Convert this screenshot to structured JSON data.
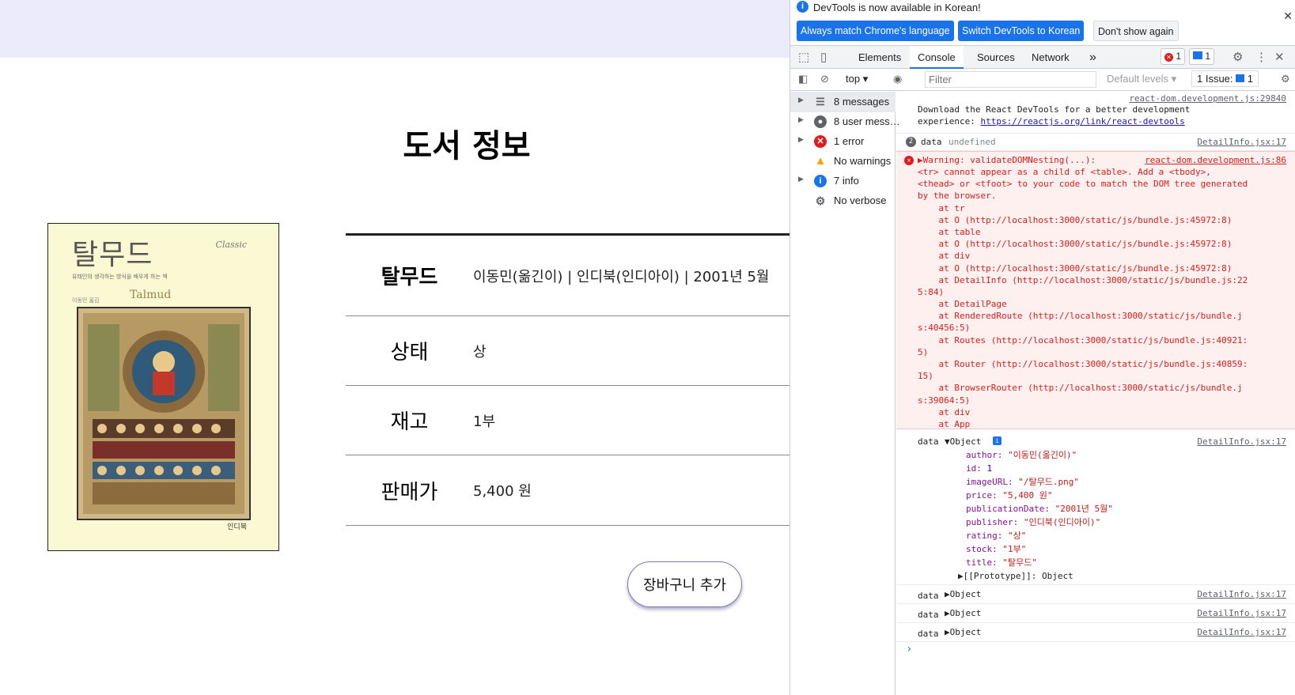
{
  "page": {
    "title": "도서 정보",
    "cover": {
      "title": "탈무드",
      "subtitle": "유태인의 생각하는 방식을 배우게 하는 책",
      "series": "Classic",
      "author": "이동민 옮김",
      "english_title": "Talmud",
      "publisher": "인디북"
    },
    "rows": [
      {
        "label": "탈무드",
        "value": "이동민(옮긴이) | 인디북(인디아이) | 2001년 5월"
      },
      {
        "label": "상태",
        "value": "상"
      },
      {
        "label": "재고",
        "value": "1부"
      },
      {
        "label": "판매가",
        "value": "5,400 원"
      }
    ],
    "cart_button": "장바구니 추가"
  },
  "devtools": {
    "notice": {
      "text": "DevTools is now available in Korean!",
      "btn_match": "Always match Chrome's language",
      "btn_switch": "Switch DevTools to Korean",
      "btn_dismiss": "Don't show again"
    },
    "tabs": [
      "Elements",
      "Console",
      "Sources",
      "Network"
    ],
    "more_tabs": "»",
    "error_count": "1",
    "message_count": "1",
    "filterbar": {
      "context": "top",
      "filter_placeholder": "Filter",
      "levels": "Default levels",
      "issues": "1 Issue:",
      "issues_count": "1"
    },
    "sidebar": [
      {
        "label": "8 messages",
        "icon": "list-icon"
      },
      {
        "label": "8 user mess…",
        "icon": "user-icon"
      },
      {
        "label": "1 error",
        "icon": "error-icon"
      },
      {
        "label": "No warnings",
        "icon": "warning-icon"
      },
      {
        "label": "7 info",
        "icon": "info-icon"
      },
      {
        "label": "No verbose",
        "icon": "gear-icon"
      }
    ],
    "console": {
      "react_src": "react-dom.development.js:29840",
      "react_msg1": "Download the React DevTools for a better development",
      "react_msg2": "experience: ",
      "react_link": "https://reactjs.org/link/react-devtools",
      "repeat_count": "2",
      "data_key": "data",
      "undefined_text": "undefined",
      "src": "DetailInfo.jsx:17",
      "warn_head": "▶Warning: validateDOMNesting(...): ",
      "warn_src": "react-dom.development.js:86",
      "warn_lines": [
        "<tr> cannot appear as a child of <table>. Add a <tbody>,",
        "<thead> or <tfoot> to your code to match the DOM tree generated",
        "by the browser.",
        "    at tr",
        "    at O (http://localhost:3000/static/js/bundle.js:45972:8)",
        "    at table",
        "    at O (http://localhost:3000/static/js/bundle.js:45972:8)",
        "    at div",
        "    at O (http://localhost:3000/static/js/bundle.js:45972:8)",
        "    at DetailInfo (http://localhost:3000/static/js/bundle.js:22",
        "5:84)",
        "    at DetailPage",
        "    at RenderedRoute (http://localhost:3000/static/js/bundle.j",
        "s:40456:5)",
        "    at Routes (http://localhost:3000/static/js/bundle.js:40921:",
        "5)",
        "    at Router (http://localhost:3000/static/js/bundle.js:40859:",
        "15)",
        "    at BrowserRouter (http://localhost:3000/static/js/bundle.j",
        "s:39064:5)",
        "    at div",
        "    at App"
      ],
      "object_label": "▼Object",
      "object_collapsed": "▶Object",
      "props": [
        {
          "k": "author",
          "v": "\"이동민(옮긴이)\"",
          "type": "str"
        },
        {
          "k": "id",
          "v": "1",
          "type": "num"
        },
        {
          "k": "imageURL",
          "v": "\"/탈무드.png\"",
          "type": "str"
        },
        {
          "k": "price",
          "v": "\"5,400 원\"",
          "type": "str"
        },
        {
          "k": "publicationDate",
          "v": "\"2001년 5월\"",
          "type": "str"
        },
        {
          "k": "publisher",
          "v": "\"인디북(인디아이)\"",
          "type": "str"
        },
        {
          "k": "rating",
          "v": "\"상\"",
          "type": "str"
        },
        {
          "k": "stock",
          "v": "\"1부\"",
          "type": "str"
        },
        {
          "k": "title",
          "v": "\"탈무드\"",
          "type": "str"
        }
      ],
      "prototype": "▶[[Prototype]]: Object",
      "prompt": "›"
    }
  }
}
